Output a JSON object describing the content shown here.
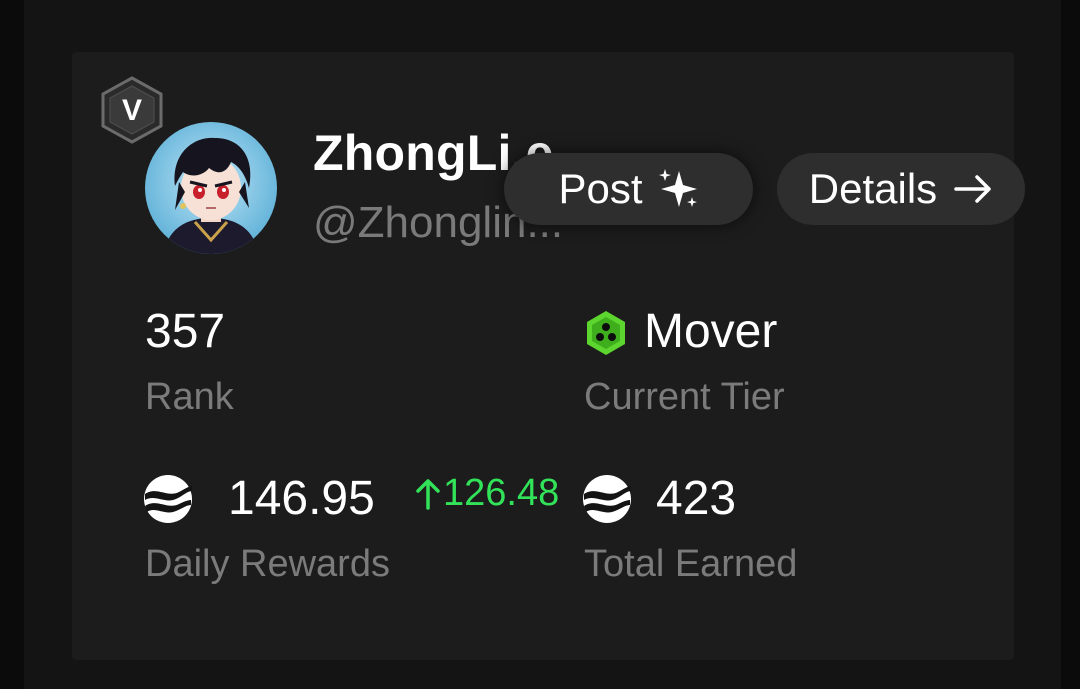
{
  "profile": {
    "badge_letter": "V",
    "username": "ZhongLi.e",
    "handle": "@Zhonglin..."
  },
  "actions": {
    "post_label": "Post",
    "details_label": "Details"
  },
  "stats": {
    "rank_value": "357",
    "rank_label": "Rank",
    "tier_value": "Mover",
    "tier_label": "Current Tier",
    "daily_rewards_value": "146.95",
    "daily_rewards_delta": "126.48",
    "daily_rewards_label": "Daily Rewards",
    "total_earned_value": "423",
    "total_earned_label": "Total Earned"
  },
  "colors": {
    "background": "#0b0b0b",
    "card": "#1c1c1c",
    "button": "#2e2e2e",
    "muted_text": "#7b7b7b",
    "positive": "#32e35a",
    "tier_green": "#5cd62e"
  },
  "icons": {
    "badge": "hexagon-v-badge-icon",
    "post": "sparkles-icon",
    "details": "arrow-right-icon",
    "tier": "hexagon-tier-icon",
    "delta": "arrow-up-icon",
    "token": "token-coin-icon"
  }
}
